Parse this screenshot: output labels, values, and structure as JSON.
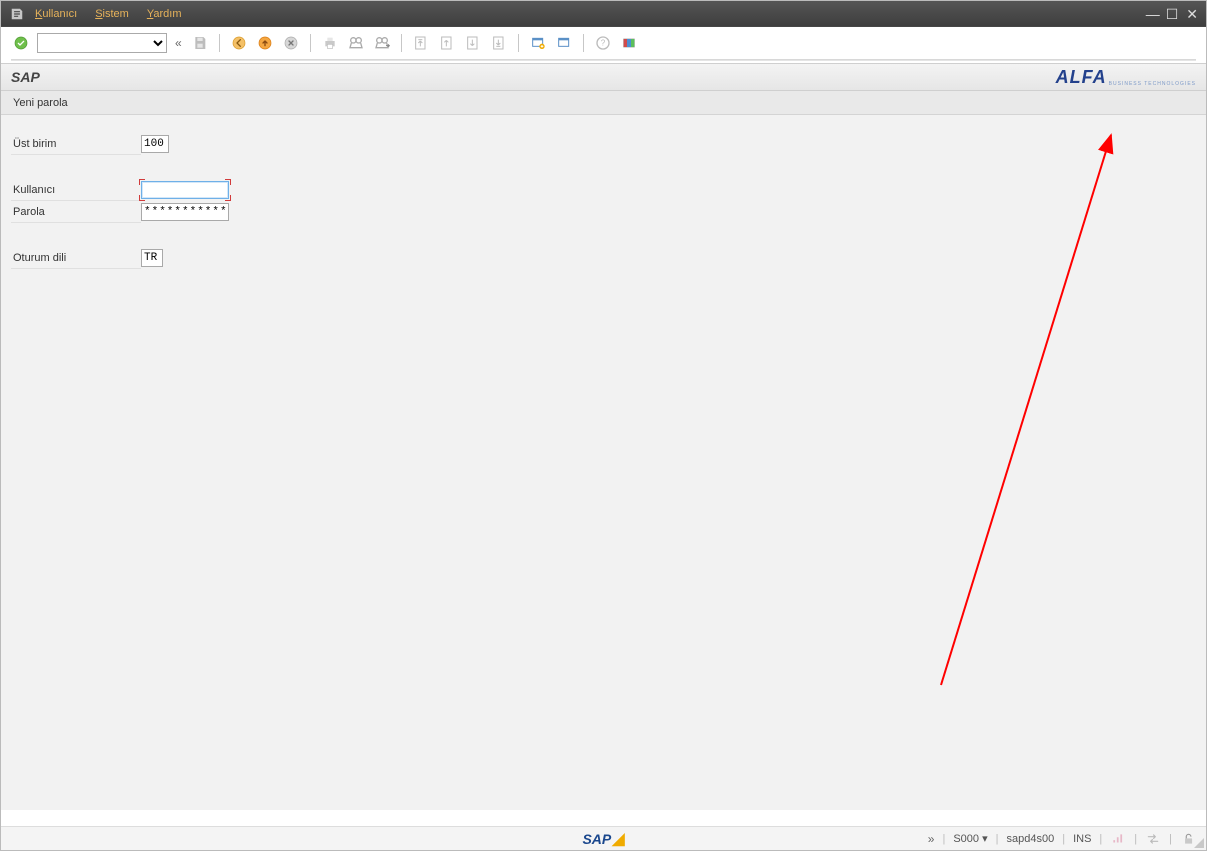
{
  "menu": {
    "user": "Kullanıcı",
    "system": "Sistem",
    "help": "Yardım"
  },
  "header": {
    "title": "SAP",
    "logo": "ALFA",
    "logo_sub": "BUSINESS TECHNOLOGIES"
  },
  "subbar": {
    "label": "Yeni parola"
  },
  "form": {
    "client_label": "Üst birim",
    "client_value": "100",
    "user_label": "Kullanıcı",
    "user_value": "",
    "password_label": "Parola",
    "password_value": "************",
    "lang_label": "Oturum dili",
    "lang_value": "TR"
  },
  "status": {
    "tcode": "S000",
    "system": "sapd4s00",
    "mode": "INS"
  }
}
